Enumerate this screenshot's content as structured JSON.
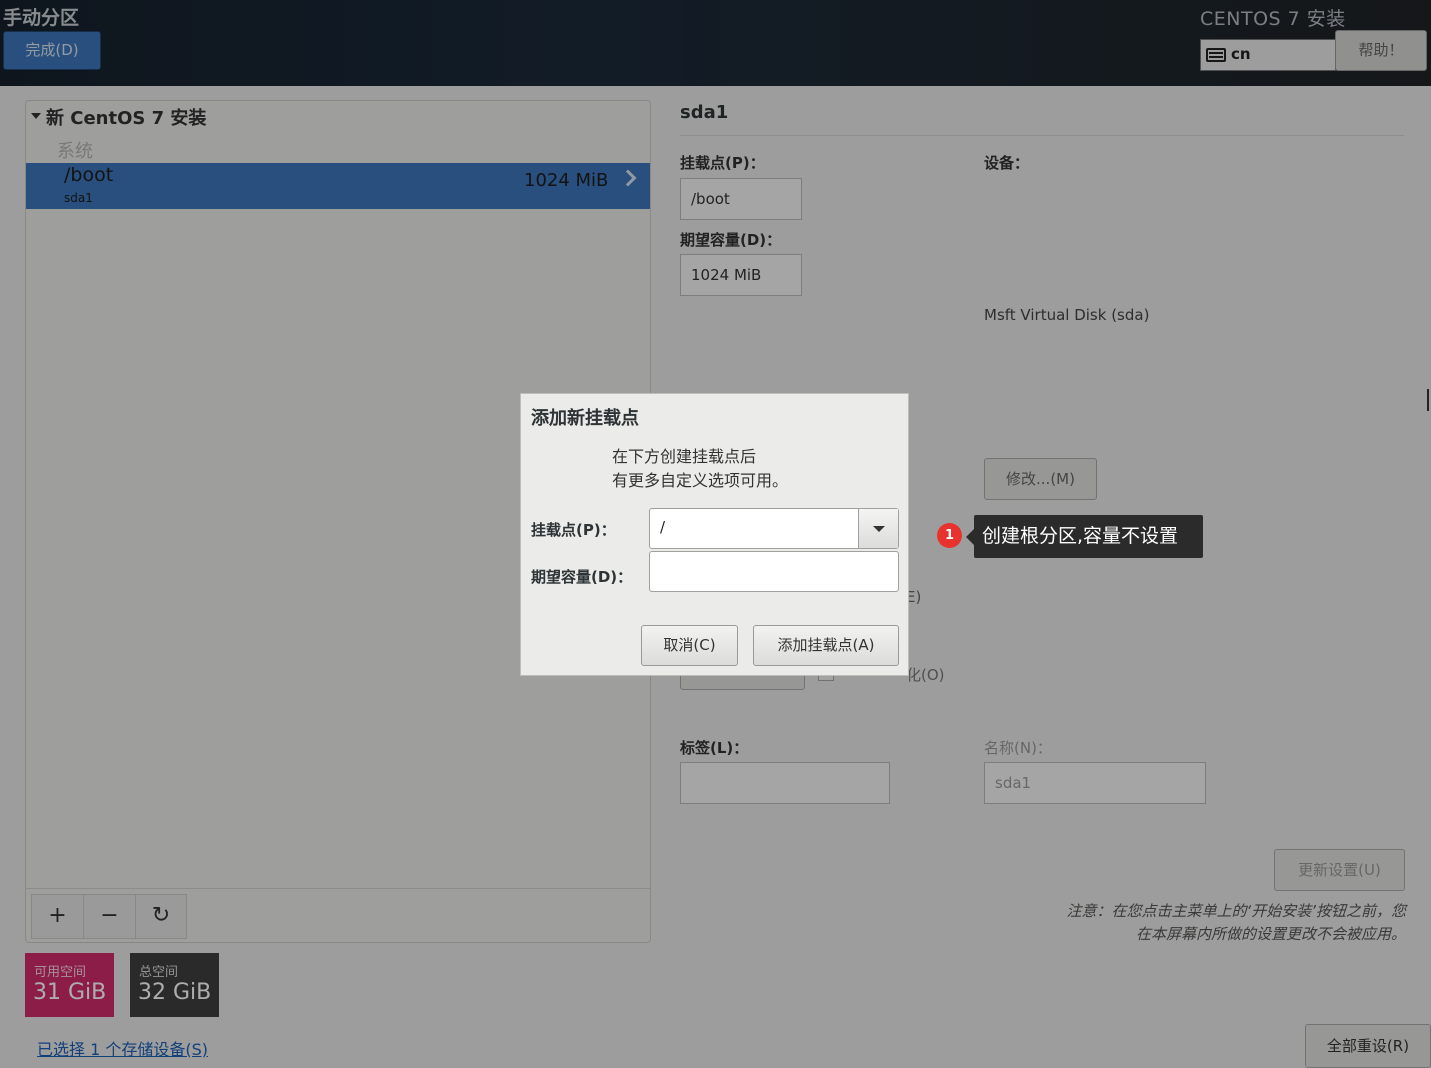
{
  "header": {
    "title": "手动分区",
    "done_button": "完成(D)",
    "os_title": "CENTOS 7 安装",
    "keyboard_layout": "cn",
    "help_button": "帮助！"
  },
  "left": {
    "group_title": "新 CentOS 7 安装",
    "category": "系统",
    "partition": {
      "mount": "/boot",
      "device": "sda1",
      "size": "1024 MiB"
    },
    "toolbar": {
      "add": "+",
      "remove": "−",
      "refresh": "C"
    },
    "available": {
      "label": "可用空间",
      "value": "31 GiB"
    },
    "total": {
      "label": "总空间",
      "value": "32 GiB"
    },
    "storage_link": "已选择 1 个存储设备(S)"
  },
  "right": {
    "title": "sda1",
    "mount_label": "挂载点(P)：",
    "mount_value": "/boot",
    "capacity_label": "期望容量(D)：",
    "capacity_value": "1024 MiB",
    "device_label": "设备：",
    "device_value": "Msft Virtual Disk (sda)",
    "modify_button": "修改...(M)",
    "encrypt_fragment": "E)",
    "reformat_fragment": "化(O)",
    "label_label": "标签(L)：",
    "label_value": "",
    "name_label": "名称(N)：",
    "name_value": "sda1",
    "update_button": "更新设置(U)",
    "note_line1": "注意：在您点击主菜单上的‘开始安装’按钮之前，您",
    "note_line2": "在本屏幕内所做的设置更改不会被应用。",
    "reset_button": "全部重设(R)"
  },
  "dialog": {
    "title": "添加新挂载点",
    "desc_line1": "在下方创建挂载点后",
    "desc_line2": "有更多自定义选项可用。",
    "mount_label": "挂载点(P)：",
    "mount_value": "/",
    "capacity_label": "期望容量(D)：",
    "capacity_value": "",
    "cancel_button": "取消(C)",
    "add_button": "添加挂载点(A)"
  },
  "annotation": {
    "number": "1",
    "text": "创建根分区,容量不设置"
  },
  "colors": {
    "accent_blue": "#3c75b8",
    "available_pink": "#cf2c6a",
    "total_dark": "#3e3e3e",
    "badge_red": "#e8322d"
  }
}
